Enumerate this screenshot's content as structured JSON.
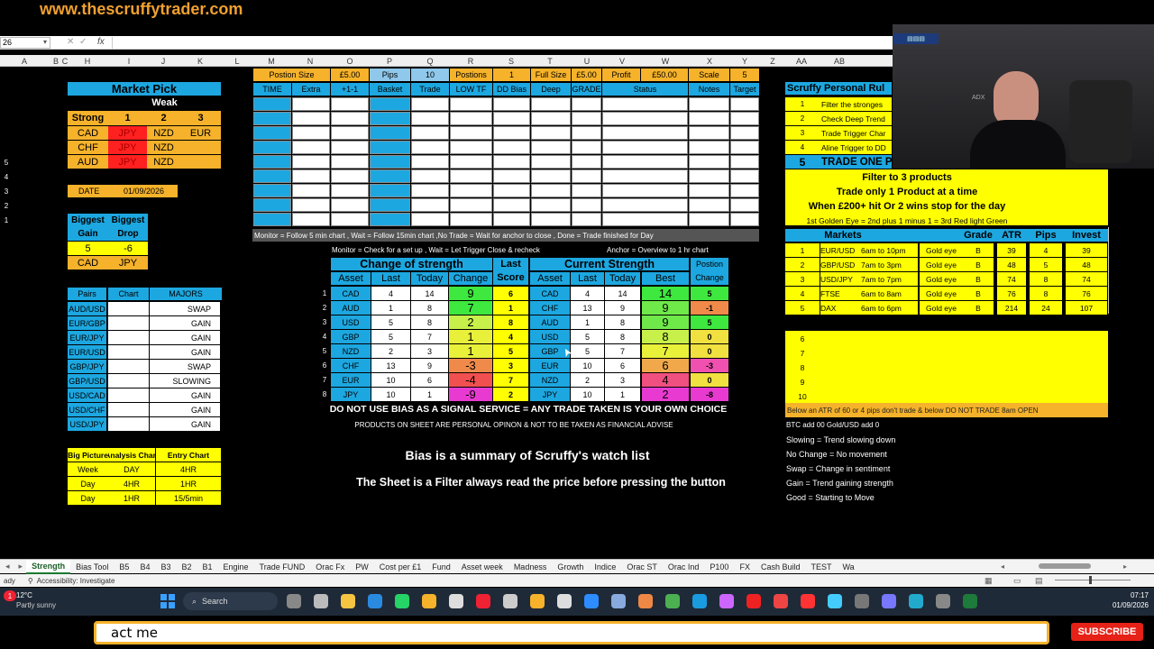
{
  "watermark": "www.thescruffytrader.com",
  "formula_bar": {
    "name_box": "26",
    "fx": "fx"
  },
  "columns": [
    "A",
    "B",
    "C",
    "H",
    "I",
    "J",
    "K",
    "L",
    "M",
    "N",
    "O",
    "P",
    "Q",
    "R",
    "S",
    "T",
    "U",
    "V",
    "W",
    "X",
    "Y",
    "Z",
    "AA",
    "AB"
  ],
  "market_pick": {
    "title": "Market Pick",
    "weak_label": "Weak",
    "strong_label": "Strong",
    "heads": [
      "1",
      "2",
      "3"
    ],
    "rows": [
      [
        "CAD",
        "JPY",
        "NZD",
        "EUR"
      ],
      [
        "CHF",
        "JPY",
        "NZD",
        ""
      ],
      [
        "AUD",
        "JPY",
        "NZD",
        ""
      ]
    ]
  },
  "date": {
    "label": "DATE",
    "value": "01/09/2026"
  },
  "biggest": {
    "gain_label": "Biggest Gain",
    "drop_label": "Biggest Drop",
    "gain_val": "5",
    "drop_val": "-6",
    "gain_ccy": "CAD",
    "drop_ccy": "JPY"
  },
  "pairs": {
    "heads": [
      "Pairs",
      "Chart",
      "MAJORS"
    ],
    "rows": [
      [
        "AUD/USD",
        "SWAP"
      ],
      [
        "EUR/GBP",
        "GAIN"
      ],
      [
        "EUR/JPY",
        "GAIN"
      ],
      [
        "EUR/USD",
        "GAIN"
      ],
      [
        "GBP/JPY",
        "SWAP"
      ],
      [
        "GBP/USD",
        "SLOWING"
      ],
      [
        "USD/CAD",
        "GAIN"
      ],
      [
        "USD/CHF",
        "GAIN"
      ],
      [
        "USD/JPY",
        "GAIN"
      ]
    ]
  },
  "big_picture": {
    "heads": [
      "Big Picture",
      "Analysis Chart",
      "Entry Chart"
    ],
    "rows": [
      [
        "Week",
        "DAY",
        "4HR"
      ],
      [
        "Day",
        "4HR",
        "1HR"
      ],
      [
        "Day",
        "1HR",
        "15/5min"
      ]
    ]
  },
  "trade_header": {
    "top": [
      "Postion Size",
      "£5.00",
      "Pips",
      "10",
      "Postions",
      "1",
      "Full Size",
      "£5.00",
      "Profit",
      "£50.00",
      "Scale",
      "5"
    ],
    "cols": [
      "TIME",
      "Extra",
      "+1-1",
      "Basket",
      "Trade",
      "LOW TF",
      "DD Bias",
      "Deep",
      "GRADE",
      "Status",
      "Notes",
      "Target"
    ],
    "row_labels": [
      "5",
      "4",
      "3",
      "2",
      "1"
    ]
  },
  "monitor_line": "Monitor = Follow 5 min chart , Wait = Follow 15min chart ,No Trade = Wait for anchor to close , Done = Trade finished for Day",
  "monitor_line2": "Monitor  = Check for a set up , Wait = Let Trigger Close & recheck",
  "anchor_line": "Anchor = Overview to 1 hr chart",
  "change_strength": {
    "title": "Change of strength",
    "last_score": "Last Score",
    "heads": [
      "Asset",
      "Last",
      "Today",
      "Change"
    ],
    "rows": [
      [
        "CAD",
        "4",
        "14",
        "9",
        "6"
      ],
      [
        "AUD",
        "1",
        "8",
        "7",
        "1"
      ],
      [
        "USD",
        "5",
        "8",
        "2",
        "8"
      ],
      [
        "GBP",
        "5",
        "7",
        "1",
        "4"
      ],
      [
        "NZD",
        "2",
        "3",
        "1",
        "5"
      ],
      [
        "CHF",
        "13",
        "9",
        "-3",
        "3"
      ],
      [
        "EUR",
        "10",
        "6",
        "-4",
        "7"
      ],
      [
        "JPY",
        "10",
        "1",
        "-9",
        "2"
      ]
    ]
  },
  "current_strength": {
    "title": "Current Strength",
    "position_change": "Postion Change",
    "heads": [
      "Asset",
      "Last",
      "Today",
      "Best"
    ],
    "rows": [
      [
        "CAD",
        "4",
        "14",
        "14",
        "5"
      ],
      [
        "CHF",
        "13",
        "9",
        "9",
        "-1"
      ],
      [
        "AUD",
        "1",
        "8",
        "9",
        "5"
      ],
      [
        "USD",
        "5",
        "8",
        "8",
        "0"
      ],
      [
        "GBP",
        "5",
        "7",
        "7",
        "0"
      ],
      [
        "EUR",
        "10",
        "6",
        "6",
        "-3"
      ],
      [
        "NZD",
        "2",
        "3",
        "4",
        "0"
      ],
      [
        "JPY",
        "10",
        "1",
        "2",
        "-8"
      ]
    ]
  },
  "row_index": [
    "1",
    "2",
    "3",
    "4",
    "5",
    "6",
    "7",
    "8"
  ],
  "disclaimer": "DO NOT USE BIAS AS A SIGNAL SERVICE = ANY TRADE TAKEN IS YOUR OWN CHOICE",
  "disclaimer2": "PRODUCTS ON SHEET ARE PERSONAL OPINON & NOT TO BE TAKEN AS FINANCIAL ADVISE",
  "bias_summary": "Bias  is a summary of Scruffy's watch list",
  "filter_note": "The Sheet is a Filter always read the price before pressing the button",
  "rules": {
    "title": "Scruffy Personal Rul",
    "items": [
      [
        "1",
        "Filter the stronges"
      ],
      [
        "2",
        "Check Deep Trend"
      ],
      [
        "3",
        "Trade Trigger Char"
      ],
      [
        "4",
        "Aline Trigger to DD"
      ],
      [
        "5",
        "TRADE ONE P"
      ]
    ],
    "filter3": "Filter to 3 products",
    "one_product": "Trade only 1 Product at a time",
    "stop_rule": "When £200+ hit Or 2 wins stop for the day",
    "golden": "1st Golden Eye = 2nd plus 1 minus 1 = 3rd Red light Green"
  },
  "markets": {
    "heads": [
      "Markets",
      "Grade",
      "ATR",
      "Pips",
      "Invest"
    ],
    "rows": [
      [
        "1",
        "EUR/USD",
        "6am to 10pm",
        "Gold eye",
        "B",
        "39",
        "4",
        "39"
      ],
      [
        "2",
        "GBP/USD",
        "7am to 3pm",
        "Gold eye",
        "B",
        "48",
        "5",
        "48"
      ],
      [
        "3",
        "USD/JPY",
        "7am to 7pm",
        "Gold eye",
        "B",
        "74",
        "8",
        "74"
      ],
      [
        "4",
        "FTSE",
        "6am to 8am",
        "Gold eye",
        "B",
        "76",
        "8",
        "76"
      ],
      [
        "5",
        "DAX",
        "6am to  6pm",
        "Gold eye",
        "B",
        "214",
        "24",
        "107"
      ]
    ]
  },
  "extra_rows": [
    "6",
    "7",
    "8",
    "9",
    "10"
  ],
  "atr_note": "Below an ATR of 60 or 4 pips don't trade & below DO NOT TRADE 8am OPEN",
  "btc_note": "BTC add 00  Gold/USD add 0",
  "legend": [
    "Slowing = Trend slowing down",
    "No Change = No movement",
    "Swap = Change in sentiment",
    "Gain = Trend gaining strength",
    "Good = Starting to Move"
  ],
  "tabs": [
    "Strength",
    "Bias Tool",
    "B5",
    "B4",
    "B3",
    "B2",
    "B1",
    "Engine",
    "Trade FUND",
    "Orac Fx",
    "PW",
    "Cost per £1",
    "Fund",
    "Asset week",
    "Madness",
    "Growth",
    "Indice",
    "Orac ST",
    "Orac Ind",
    "P100",
    "FX",
    "Cash Build",
    "TEST",
    "Wa"
  ],
  "status": {
    "ready": "ady",
    "accessibility": "Accessibility: Investigate"
  },
  "weather": {
    "temp": "12°C",
    "desc": "Partly sunny",
    "badge": "1"
  },
  "search": "Search",
  "clock": {
    "time": "07:17",
    "date": "01/09/2026"
  },
  "caption": "act me",
  "subscribe": "SUBSCRIBE",
  "webcam_label": "ADX"
}
